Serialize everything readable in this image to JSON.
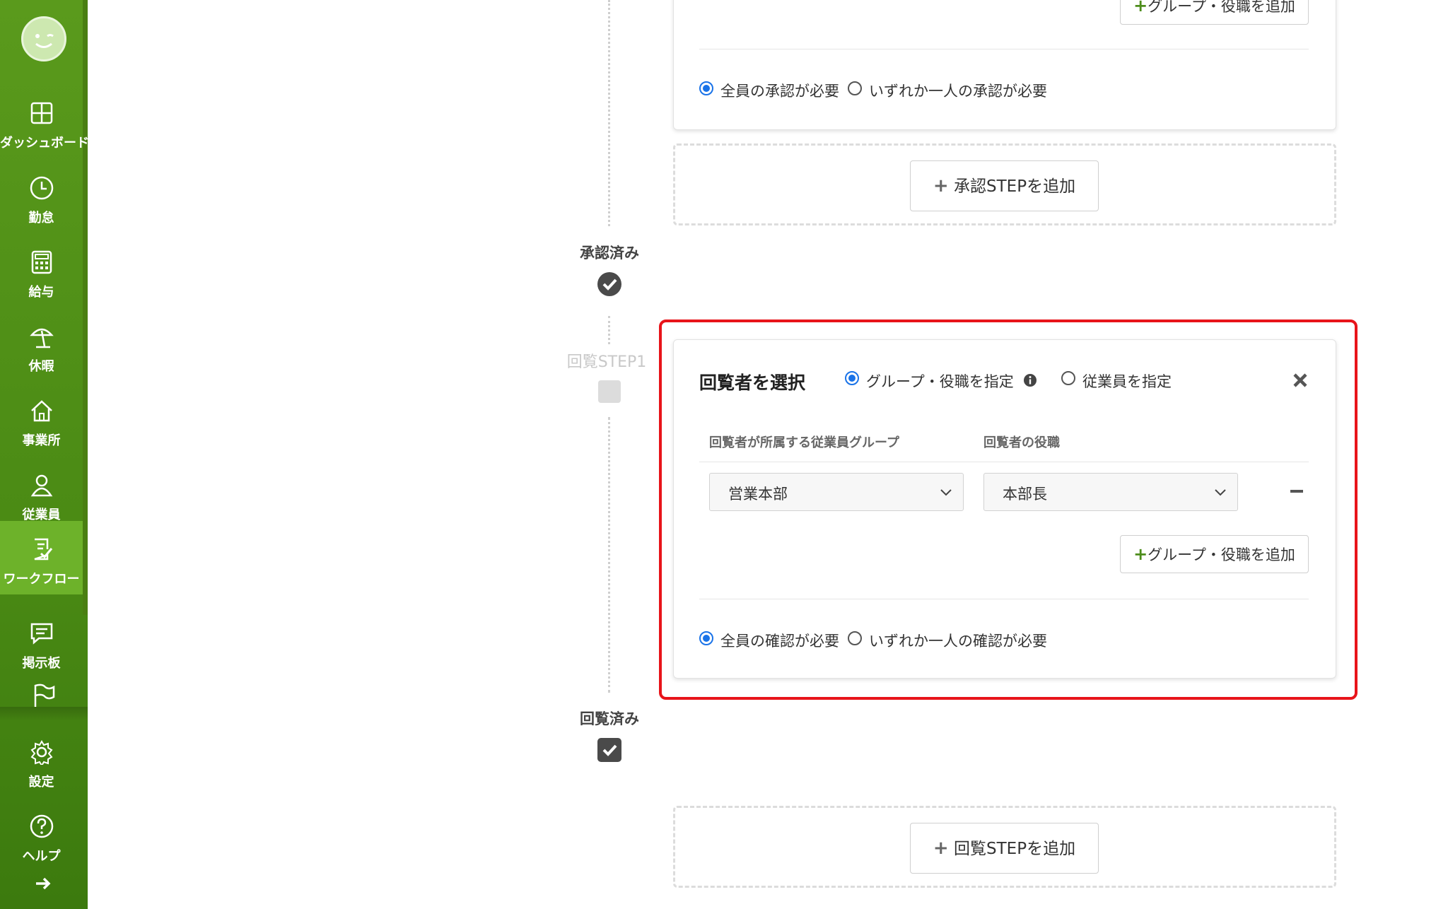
{
  "sidebar": {
    "colors": {
      "bg": "#4a8a14",
      "active": "#6db22a"
    },
    "items": [
      {
        "label": "ダッシュボード",
        "icon": "dashboard-icon"
      },
      {
        "label": "勤怠",
        "icon": "clock-icon"
      },
      {
        "label": "給与",
        "icon": "calculator-icon"
      },
      {
        "label": "休暇",
        "icon": "beach-umbrella-icon"
      },
      {
        "label": "事業所",
        "icon": "home-icon"
      },
      {
        "label": "従業員",
        "icon": "person-icon"
      },
      {
        "label": "ワークフロー",
        "icon": "workflow-icon"
      },
      {
        "label": "掲示板",
        "icon": "message-board-icon"
      },
      {
        "label": "設定",
        "icon": "gear-icon"
      },
      {
        "label": "ヘルプ",
        "icon": "help-icon"
      }
    ],
    "active_item": "ワークフロー"
  },
  "approval_card": {
    "add_group_role_button": "グループ・役職を追加",
    "radio_all": "全員の承認が必要",
    "radio_any": "いずれか一人の承認が必要"
  },
  "add_approval_step_button": "承認STEPを追加",
  "status_approved": "承認済み",
  "status_step_label": "回覧STEP1",
  "circulation_card": {
    "title": "回覧者を選択",
    "mode_group_role": "グループ・役職を指定",
    "mode_employee": "従業員を指定",
    "col_group": "回覧者が所属する従業員グループ",
    "col_role": "回覧者の役職",
    "group_value": "営業本部",
    "role_value": "本部長",
    "add_group_role_button": "グループ・役職を追加",
    "radio_all": "全員の確認が必要",
    "radio_any": "いずれか一人の確認が必要"
  },
  "status_circulated": "回覧済み",
  "add_circulation_step_button": "回覧STEPを追加",
  "highlight_color": "#e8141a"
}
